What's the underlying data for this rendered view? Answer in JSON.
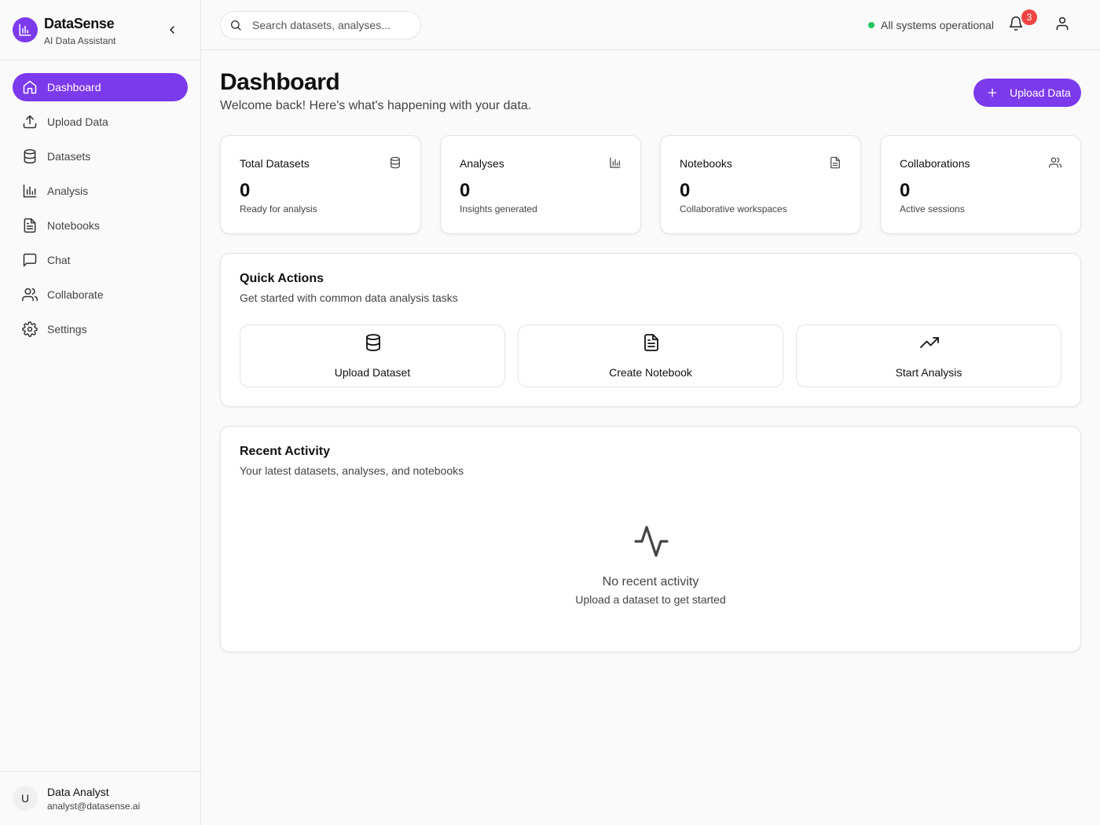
{
  "app": {
    "name": "DataSense",
    "subtitle": "AI Data Assistant"
  },
  "sidebar": {
    "items": [
      {
        "label": "Dashboard",
        "icon": "home-icon",
        "active": true
      },
      {
        "label": "Upload Data",
        "icon": "upload-icon"
      },
      {
        "label": "Datasets",
        "icon": "database-icon"
      },
      {
        "label": "Analysis",
        "icon": "bar-chart-icon"
      },
      {
        "label": "Notebooks",
        "icon": "file-text-icon"
      },
      {
        "label": "Chat",
        "icon": "message-square-icon"
      },
      {
        "label": "Collaborate",
        "icon": "users-icon"
      },
      {
        "label": "Settings",
        "icon": "gear-icon"
      }
    ],
    "user": {
      "initial": "U",
      "name": "Data Analyst",
      "email": "analyst@datasense.ai"
    }
  },
  "topbar": {
    "search_placeholder": "Search datasets, analyses...",
    "status_text": "All systems operational",
    "status_color": "#22c55e",
    "notification_count": "3"
  },
  "page": {
    "title": "Dashboard",
    "subtitle": "Welcome back! Here's what's happening with your data.",
    "upload_button": "Upload Data"
  },
  "stats": [
    {
      "title": "Total Datasets",
      "value": "0",
      "desc": "Ready for analysis",
      "icon": "database-icon"
    },
    {
      "title": "Analyses",
      "value": "0",
      "desc": "Insights generated",
      "icon": "bar-chart-icon"
    },
    {
      "title": "Notebooks",
      "value": "0",
      "desc": "Collaborative workspaces",
      "icon": "file-text-icon"
    },
    {
      "title": "Collaborations",
      "value": "0",
      "desc": "Active sessions",
      "icon": "users-icon"
    }
  ],
  "quick_actions": {
    "title": "Quick Actions",
    "subtitle": "Get started with common data analysis tasks",
    "items": [
      {
        "label": "Upload Dataset",
        "icon": "database-icon"
      },
      {
        "label": "Create Notebook",
        "icon": "file-text-icon"
      },
      {
        "label": "Start Analysis",
        "icon": "trending-up-icon"
      }
    ]
  },
  "recent_activity": {
    "title": "Recent Activity",
    "subtitle": "Your latest datasets, analyses, and notebooks",
    "empty_title": "No recent activity",
    "empty_sub": "Upload a dataset to get started"
  },
  "colors": {
    "accent": "#7c3aed",
    "badge": "#ef4444"
  }
}
